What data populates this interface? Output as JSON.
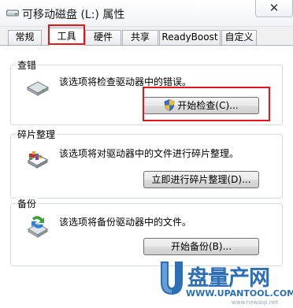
{
  "window": {
    "title": "可移动磁盘 (L:) 属性",
    "close_glyph": "✕",
    "drive_icon": "drive-icon"
  },
  "tabs": [
    {
      "label": "常规",
      "active": false
    },
    {
      "label": "工具",
      "active": true
    },
    {
      "label": "硬件",
      "active": false
    },
    {
      "label": "共享",
      "active": false
    },
    {
      "label": "ReadyBoost",
      "active": false
    },
    {
      "label": "自定义",
      "active": false
    }
  ],
  "error_check": {
    "title": "查错",
    "description": "该选项将检查驱动器中的错误。",
    "button_label": "开始检查(C)...",
    "icon": "disk-check-icon",
    "button_icon": "uac-shield-icon"
  },
  "defrag": {
    "title": "碎片整理",
    "description": "该选项将对驱动器中的文件进行碎片整理。",
    "button_label": "立即进行碎片整理(D)...",
    "icon": "defrag-icon"
  },
  "backup": {
    "title": "备份",
    "description": "该选项将备份驱动器中的文件。",
    "button_label": "开始备份(B)...",
    "icon": "backup-icon"
  },
  "watermark": {
    "brand": "盘量产网",
    "letter": "U",
    "url": "WWW.UPANTOOL.COM",
    "sub": "www.newasp.net"
  },
  "colors": {
    "highlight": "#e2161d",
    "brand_blue": "#2c6fb6"
  }
}
